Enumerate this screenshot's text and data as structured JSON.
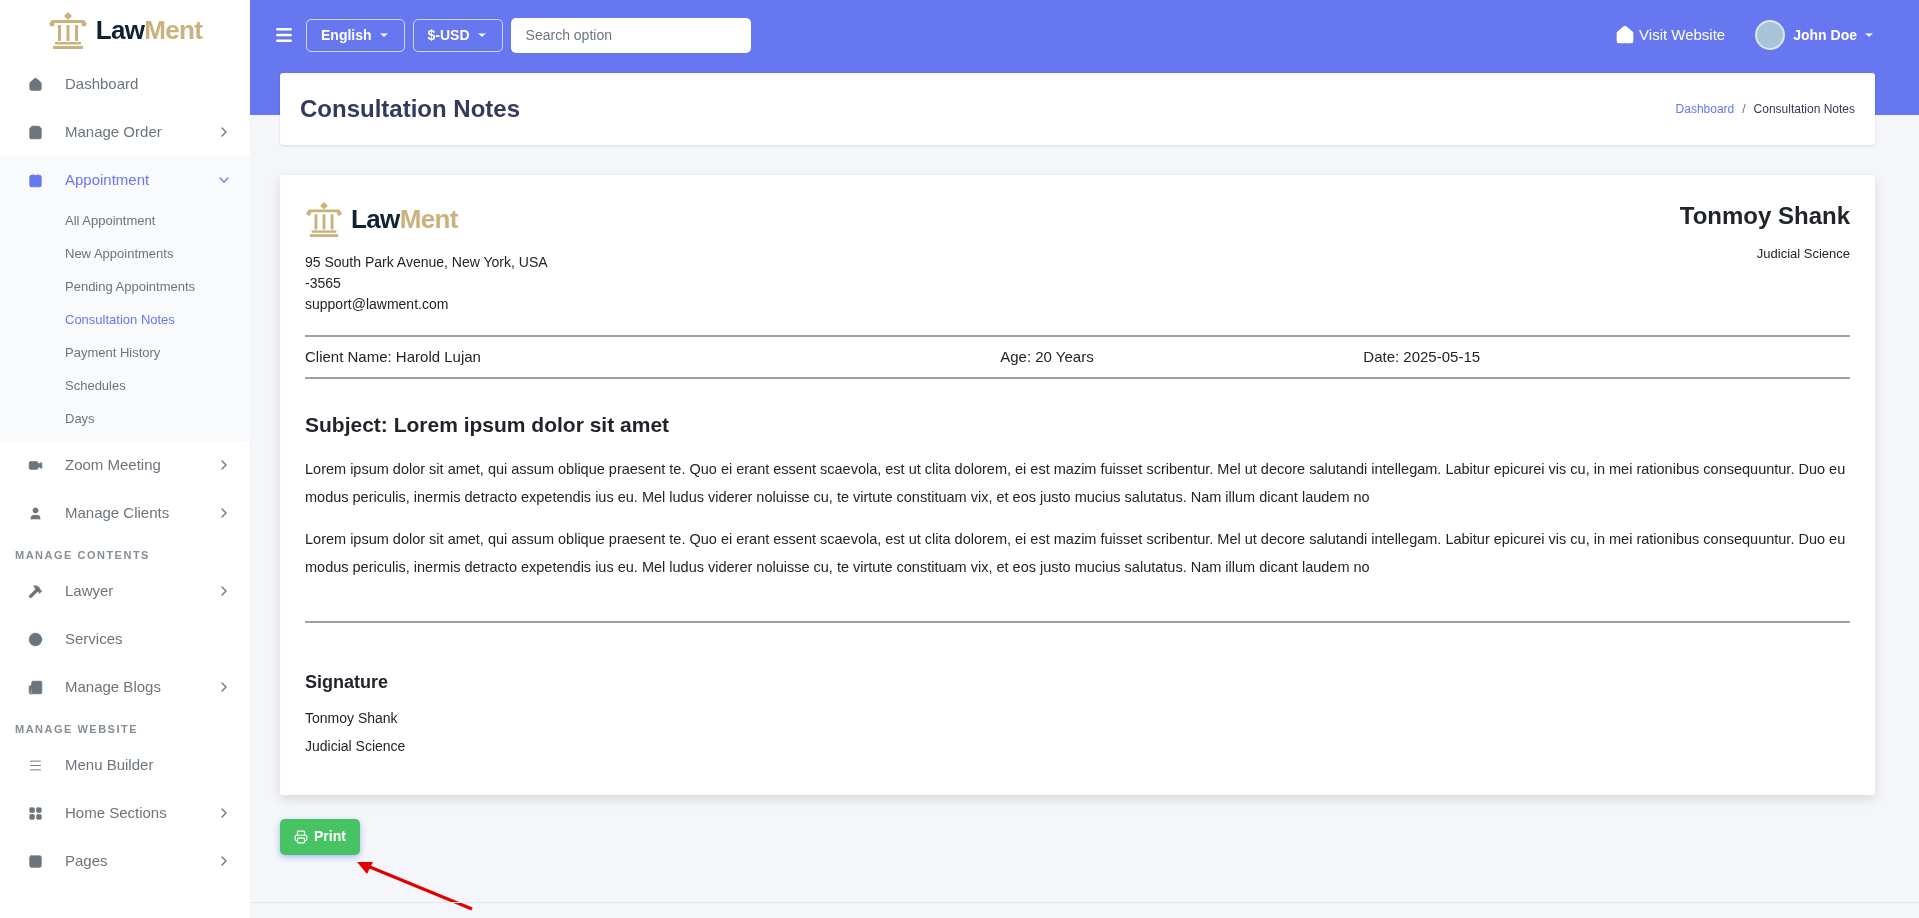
{
  "sidebar": {
    "logo": {
      "part_1": "Law",
      "part_2": "Ment"
    },
    "items": [
      {
        "kind": "item",
        "label": "Dashboard",
        "submenu": false,
        "selected": false
      },
      {
        "kind": "item",
        "label": "Manage Order",
        "submenu": true,
        "expanded": false,
        "selected": false
      },
      {
        "kind": "item",
        "label": "Appointment",
        "submenu": true,
        "expanded": true,
        "selected": true,
        "children": [
          {
            "label": "All Appointment",
            "selected": false
          },
          {
            "label": "New Appointments",
            "selected": false
          },
          {
            "label": "Pending Appointments",
            "selected": false
          },
          {
            "label": "Consultation Notes",
            "selected": true
          },
          {
            "label": "Payment History",
            "selected": false
          },
          {
            "label": "Schedules",
            "selected": false
          },
          {
            "label": "Days",
            "selected": false
          }
        ]
      },
      {
        "kind": "item",
        "label": "Zoom Meeting",
        "submenu": true,
        "expanded": false,
        "selected": false
      },
      {
        "kind": "item",
        "label": "Manage Clients",
        "submenu": true,
        "expanded": false,
        "selected": false
      },
      {
        "kind": "section",
        "label": "MANAGE CONTENTS"
      },
      {
        "kind": "item",
        "label": "Lawyer",
        "submenu": true,
        "expanded": false,
        "selected": false
      },
      {
        "kind": "item",
        "label": "Services",
        "submenu": false,
        "selected": false
      },
      {
        "kind": "item",
        "label": "Manage Blogs",
        "submenu": true,
        "expanded": false,
        "selected": false
      },
      {
        "kind": "section",
        "label": "MANAGE WEBSITE"
      },
      {
        "kind": "item",
        "label": "Menu Builder",
        "submenu": false,
        "selected": false
      },
      {
        "kind": "item",
        "label": "Home Sections",
        "submenu": true,
        "expanded": false,
        "selected": false
      },
      {
        "kind": "item",
        "label": "Pages",
        "submenu": true,
        "expanded": false,
        "selected": false
      }
    ]
  },
  "topbar": {
    "language": "English",
    "currency": "$-USD",
    "search": {
      "placeholder": "Search option"
    },
    "visit_website": "Visit Website",
    "user": "John Doe"
  },
  "page_header": {
    "title": "Consultation Notes",
    "breadcrumb_separator": "/",
    "breadcrumb": [
      {
        "kind": "link",
        "label": "Dashboard"
      },
      {
        "kind": "current",
        "label": "Consultation Notes"
      }
    ]
  },
  "note": {
    "logo": {
      "part_1": "Law",
      "part_2": "Ment"
    },
    "address_lines": [
      "95 South Park Avenue, New York, USA",
      "-3565",
      "support@lawment.com"
    ],
    "lawyer_name": "Tonmoy Shank",
    "lawyer_title": "Judicial Science",
    "info": [
      "Client Name: Harold Lujan",
      "Age: 20 Years",
      "Date: 2025-05-15"
    ],
    "subject": "Subject: Lorem ipsum dolor sit amet",
    "paragraphs": [
      "Lorem ipsum dolor sit amet, qui assum oblique praesent te. Quo ei erant essent scaevola, est ut clita dolorem, ei est mazim fuisset scribentur. Mel ut decore salutandi intellegam. Labitur epicurei vis cu, in mei rationibus consequuntur. Duo eu modus periculis, inermis detracto expetendis ius eu. Mel ludus viderer noluisse cu, te virtute constituam vix, et eos justo mucius salutatus. Nam illum dicant laudem no",
      "Lorem ipsum dolor sit amet, qui assum oblique praesent te. Quo ei erant essent scaevola, est ut clita dolorem, ei est mazim fuisset scribentur. Mel ut decore salutandi intellegam. Labitur epicurei vis cu, in mei rationibus consequuntur. Duo eu modus periculis, inermis detracto expetendis ius eu. Mel ludus viderer noluisse cu, te virtute constituam vix, et eos justo mucius salutatus. Nam illum dicant laudem no"
    ],
    "signature_heading": "Signature",
    "signature_lines": [
      "Tonmoy Shank",
      "Judicial Science"
    ]
  },
  "print_button": "Print"
}
